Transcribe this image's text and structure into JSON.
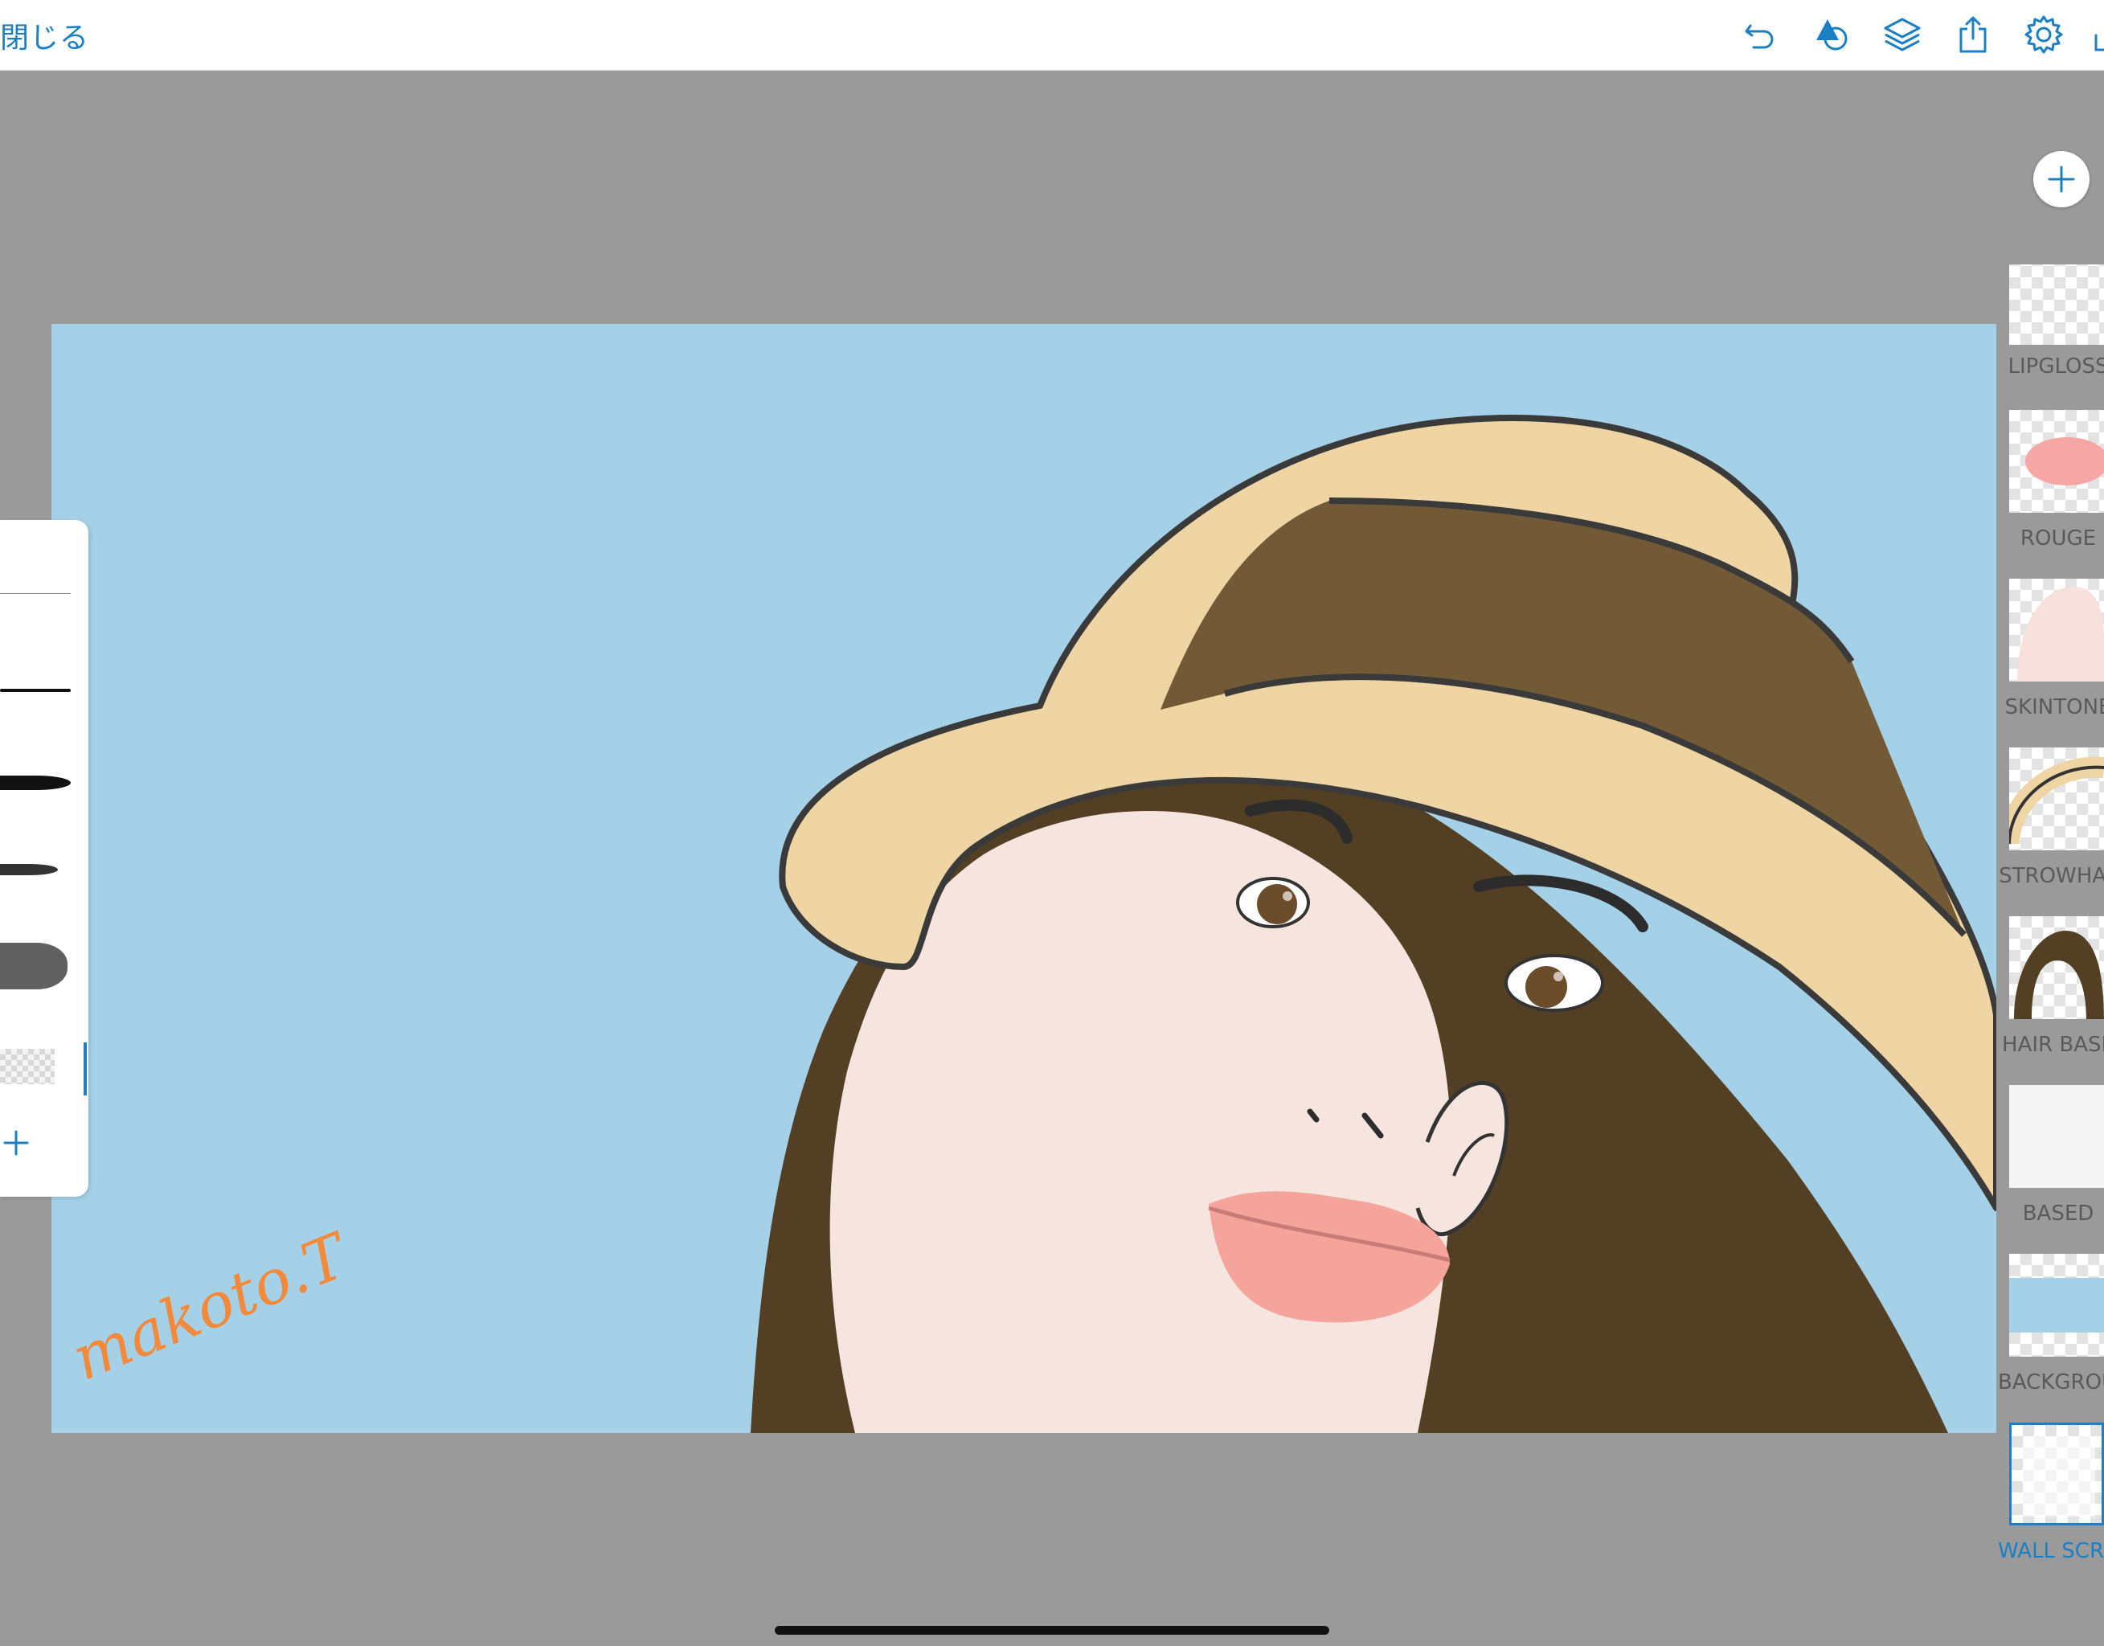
{
  "topbar": {
    "close_label": "閉じる",
    "icons": [
      "undo-icon",
      "shapes-icon",
      "layers-icon",
      "share-icon",
      "settings-icon",
      "fullscreen-icon"
    ]
  },
  "canvas": {
    "background_color": "#a4d0e8",
    "signature_text": "makoto.T"
  },
  "brush_panel": {
    "add_brush_icon": "plus-icon"
  },
  "layers_panel": {
    "add_layer_icon": "plus-icon",
    "layers": [
      {
        "name": "LIPGLOSS",
        "selected": false
      },
      {
        "name": "ROUGE",
        "selected": false
      },
      {
        "name": "SKINTONE",
        "selected": false
      },
      {
        "name": "STROWHAT",
        "selected": false
      },
      {
        "name": "HAIR BASE",
        "selected": false
      },
      {
        "name": "BASED",
        "selected": false
      },
      {
        "name": "BACKGROUND",
        "selected": false
      },
      {
        "name": "WALL SCREEN",
        "selected": true
      }
    ]
  },
  "colors": {
    "accent": "#1b7fc4",
    "workspace_gray": "#9a9a9a",
    "hat": "#eed5a3",
    "hat_band": "#725a37",
    "hair": "#533f24",
    "skin": "#f6e4df",
    "lips": "#f4a49a",
    "signature": "#f5893a"
  }
}
